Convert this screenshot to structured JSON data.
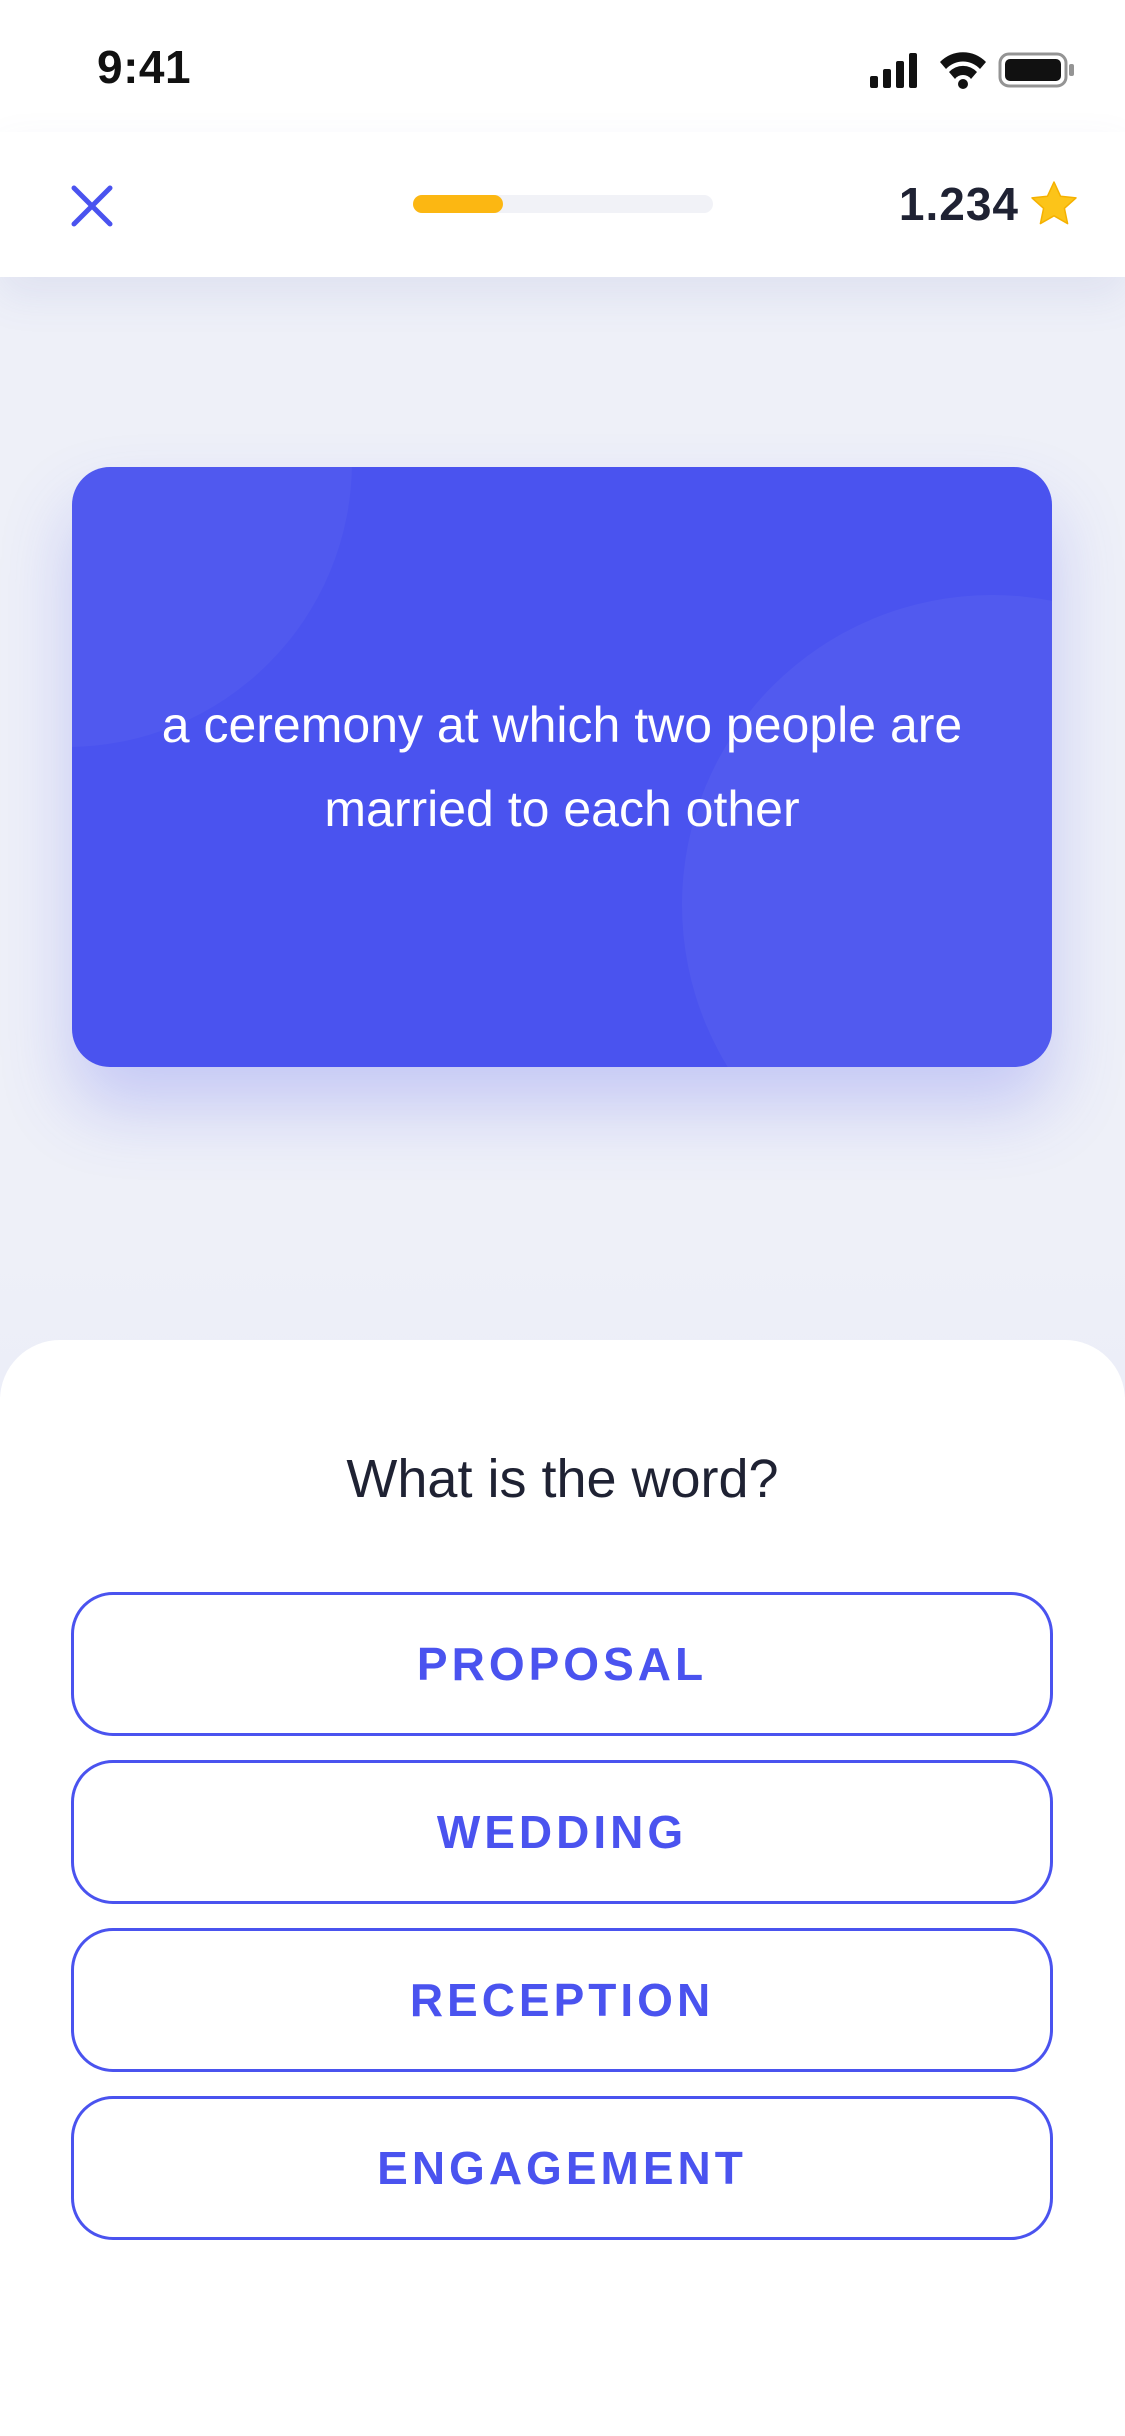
{
  "status_bar": {
    "time": "9:41",
    "icons": [
      "cellular-signal-icon",
      "wifi-icon",
      "battery-icon"
    ]
  },
  "header": {
    "close_icon": "close-icon",
    "progress_fraction": 0.3,
    "score": "1.234",
    "score_icon": "star-icon"
  },
  "card": {
    "definition": "a ceremony at which two people are married to each other"
  },
  "quiz": {
    "question": "What is the word?",
    "options": [
      {
        "label": "PROPOSAL"
      },
      {
        "label": "WEDDING"
      },
      {
        "label": "RECEPTION"
      },
      {
        "label": "ENGAGEMENT"
      }
    ]
  },
  "colors": {
    "accent": "#4a53ef",
    "progress": "#fcb712",
    "star": "#fcc419",
    "text_dark": "#1f2233",
    "background": "#eef0f8"
  }
}
